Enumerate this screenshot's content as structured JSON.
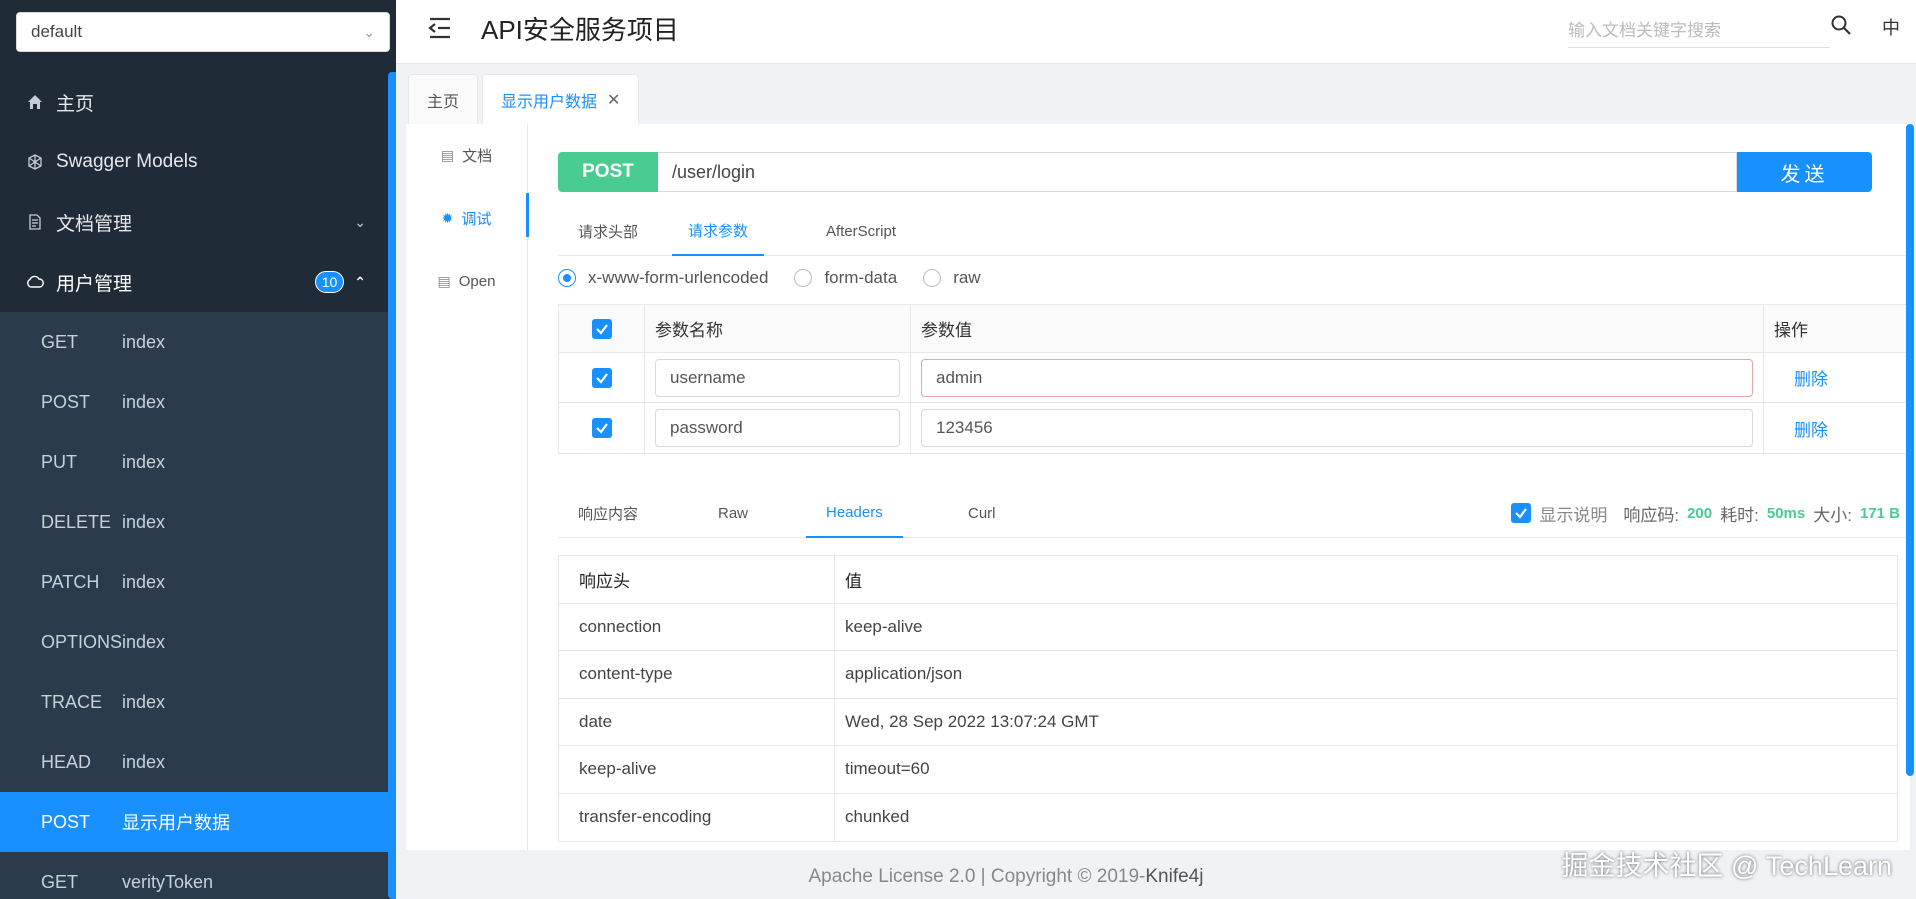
{
  "group_select": {
    "value": "default"
  },
  "nav": {
    "home": "主页",
    "models": "Swagger Models",
    "docs": "文档管理",
    "users": "用户管理",
    "users_badge": "10"
  },
  "sub_items": [
    {
      "method": "GET",
      "name": "index"
    },
    {
      "method": "POST",
      "name": "index"
    },
    {
      "method": "PUT",
      "name": "index"
    },
    {
      "method": "DELETE",
      "name": "index"
    },
    {
      "method": "PATCH",
      "name": "index"
    },
    {
      "method": "OPTIONS",
      "name": "index"
    },
    {
      "method": "TRACE",
      "name": "index"
    },
    {
      "method": "HEAD",
      "name": "index"
    },
    {
      "method": "POST",
      "name": "显示用户数据"
    },
    {
      "method": "GET",
      "name": "verityToken"
    }
  ],
  "header": {
    "title": "API安全服务项目",
    "search_placeholder": "输入文档关键字搜索",
    "lang": "中"
  },
  "tabs": [
    {
      "label": "主页"
    },
    {
      "label": "显示用户数据"
    }
  ],
  "vtabs": {
    "doc": "文档",
    "debug": "调试",
    "open": "Open"
  },
  "request": {
    "method": "POST",
    "url": "/user/login",
    "send": "发送"
  },
  "req_tabs": {
    "headers": "请求头部",
    "params": "请求参数",
    "after": "AfterScript"
  },
  "body_types": {
    "urlencoded": "x-www-form-urlencoded",
    "formdata": "form-data",
    "raw": "raw"
  },
  "params_table": {
    "col_name": "参数名称",
    "col_value": "参数值",
    "col_op": "操作",
    "rows": [
      {
        "name": "username",
        "value": "admin",
        "op": "删除"
      },
      {
        "name": "password",
        "value": "123456",
        "op": "删除"
      }
    ]
  },
  "resp_tabs": {
    "content": "响应内容",
    "raw": "Raw",
    "headers": "Headers",
    "curl": "Curl"
  },
  "resp_info": {
    "show_desc": "显示说明",
    "code_label": "响应码:",
    "code": "200",
    "time_label": "耗时:",
    "time": "50ms",
    "size_label": "大小:",
    "size": "171 B"
  },
  "headers_table": {
    "col_key": "响应头",
    "col_val": "值",
    "rows": [
      {
        "k": "connection",
        "v": "keep-alive"
      },
      {
        "k": "content-type",
        "v": "application/json"
      },
      {
        "k": "date",
        "v": "Wed, 28 Sep 2022 13:07:24 GMT"
      },
      {
        "k": "keep-alive",
        "v": "timeout=60"
      },
      {
        "k": "transfer-encoding",
        "v": "chunked"
      }
    ]
  },
  "footer": {
    "text": "Apache License 2.0 | Copyright © 2019-",
    "brand": "Knife4j"
  },
  "watermark": "掘金技术社区 @ TechLearn",
  "colors": {
    "accent": "#1890ff",
    "post": "#49cc90",
    "sidebar": "#1f2b37"
  }
}
